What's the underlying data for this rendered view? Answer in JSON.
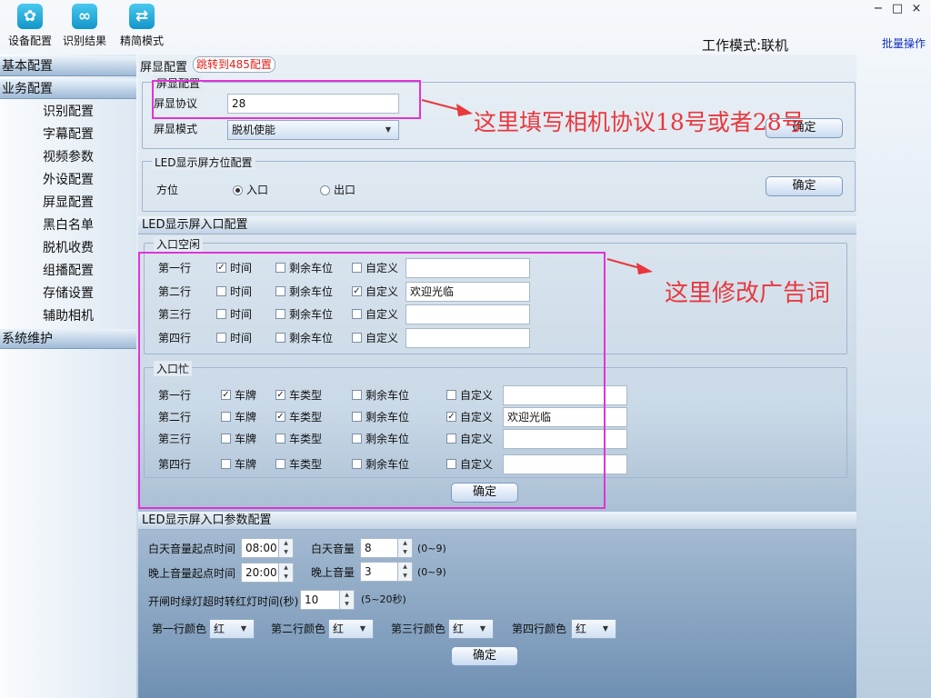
{
  "toolbar": {
    "items": [
      {
        "label": "设备配置",
        "icon": "gear-icon"
      },
      {
        "label": "识别结果",
        "icon": "infinity-icon"
      },
      {
        "label": "精简模式",
        "icon": "swap-icon"
      }
    ]
  },
  "header": {
    "work_mode": "工作模式:联机",
    "batch": "批量操作",
    "controls": [
      "−",
      "□",
      "×"
    ]
  },
  "sidebar": {
    "basic": "基本配置",
    "business": "业务配置",
    "items": [
      "识别配置",
      "字幕配置",
      "视频参数",
      "外设配置",
      "屏显配置",
      "黑白名单",
      "脱机收费",
      "组播配置",
      "存储设置",
      "辅助相机"
    ],
    "system": "系统维护"
  },
  "main": {
    "tab": {
      "title": "屏显配置",
      "link": "跳转到485配置"
    },
    "screen": {
      "title": "屏显配置",
      "protocol_label": "屏显协议",
      "protocol_value": "28",
      "mode_label": "屏显模式",
      "mode_value": "脱机使能",
      "ok": "确定"
    },
    "direction": {
      "title": "LED显示屏方位配置",
      "label": "方位",
      "entry": "入口",
      "exit": "出口",
      "selected": "入口",
      "ok": "确定"
    },
    "entry": {
      "section": "LED显示屏入口配置",
      "idle": {
        "title": "入口空闲",
        "rows": [
          {
            "label": "第一行",
            "time": true,
            "spaces": false,
            "custom": false,
            "text": ""
          },
          {
            "label": "第二行",
            "time": false,
            "spaces": false,
            "custom": true,
            "text": "欢迎光临"
          },
          {
            "label": "第三行",
            "time": false,
            "spaces": false,
            "custom": false,
            "text": ""
          },
          {
            "label": "第四行",
            "time": false,
            "spaces": false,
            "custom": false,
            "text": ""
          }
        ],
        "labels": {
          "time": "时间",
          "spaces": "剩余车位",
          "custom": "自定义"
        }
      },
      "busy": {
        "title": "入口忙",
        "rows": [
          {
            "label": "第一行",
            "plate": true,
            "type": true,
            "spaces": false,
            "custom": false,
            "text": ""
          },
          {
            "label": "第二行",
            "plate": false,
            "type": true,
            "spaces": false,
            "custom": true,
            "text": "欢迎光临"
          },
          {
            "label": "第三行",
            "plate": false,
            "type": false,
            "spaces": false,
            "custom": false,
            "text": ""
          },
          {
            "label": "第四行",
            "plate": false,
            "type": false,
            "spaces": false,
            "custom": false,
            "text": ""
          }
        ],
        "labels": {
          "plate": "车牌",
          "type": "车类型",
          "spaces": "剩余车位",
          "custom": "自定义"
        }
      },
      "ok": "确定"
    },
    "params": {
      "section": "LED显示屏入口参数配置",
      "day_start_label": "白天音量起点时间",
      "day_start": "08:00",
      "day_volume_label": "白天音量",
      "day_volume": "8",
      "range1": "(0~9)",
      "night_start_label": "晚上音量起点时间",
      "night_start": "20:00",
      "night_volume_label": "晚上音量",
      "night_volume": "3",
      "range2": "(0~9)",
      "timeout_label": "开闸时绿灯超时转红灯时间(秒)",
      "timeout": "10",
      "range3": "(5~20秒)",
      "colors": [
        {
          "label": "第一行颜色",
          "value": "红"
        },
        {
          "label": "第二行颜色",
          "value": "红"
        },
        {
          "label": "第三行颜色",
          "value": "红"
        },
        {
          "label": "第四行颜色",
          "value": "红"
        }
      ],
      "ok": "确定"
    }
  },
  "annotations": {
    "a1": "这里填写相机协议18号或者28号",
    "a2": "这里修改广告词"
  },
  "colors": {
    "annotation": "#e8383d",
    "highlight": "#e033d8"
  }
}
